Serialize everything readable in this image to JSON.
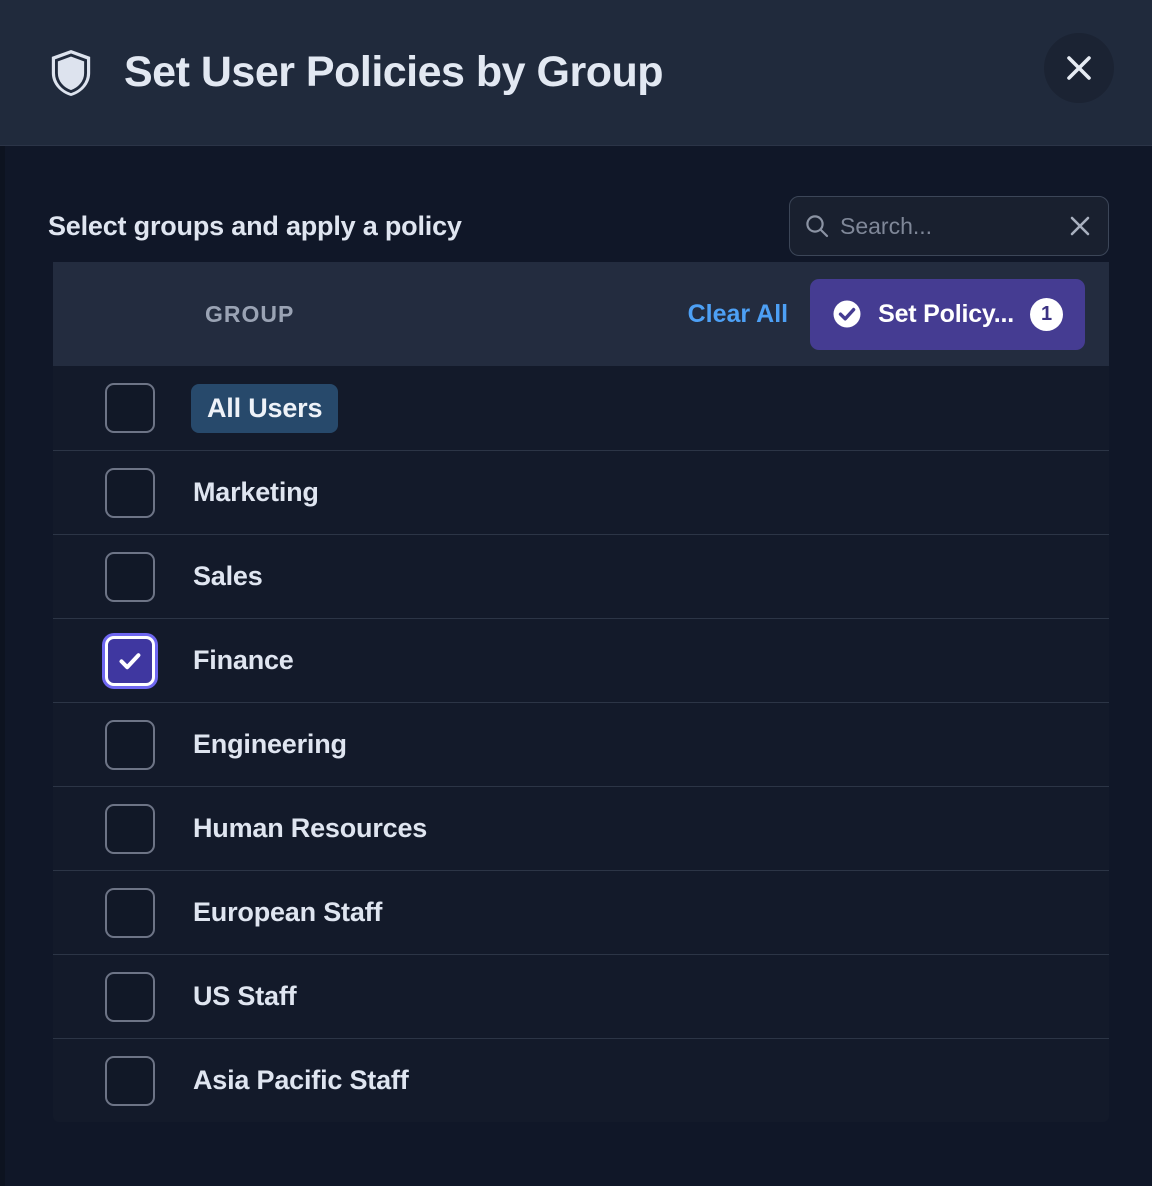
{
  "header": {
    "icon": "shield-icon",
    "title": "Set User Policies by Group",
    "close_icon": "close-icon",
    "background": "#202a3c"
  },
  "body": {
    "section_label": "Select groups and apply a policy",
    "search": {
      "icon": "search-icon",
      "value": "",
      "placeholder": "Search...",
      "clear_icon": "close-icon"
    }
  },
  "table": {
    "column_header": "GROUP",
    "clear_all_label": "Clear All",
    "action_button": {
      "icon": "check-circle-icon",
      "label": "Set Policy...",
      "count": "1",
      "color": "#453c92"
    },
    "rows": [
      {
        "name": "All Users",
        "checked": false,
        "highlighted": true
      },
      {
        "name": "Marketing",
        "checked": false,
        "highlighted": false
      },
      {
        "name": "Sales",
        "checked": false,
        "highlighted": false
      },
      {
        "name": "Finance",
        "checked": true,
        "highlighted": false
      },
      {
        "name": "Engineering",
        "checked": false,
        "highlighted": false
      },
      {
        "name": "Human Resources",
        "checked": false,
        "highlighted": false
      },
      {
        "name": "European Staff",
        "checked": false,
        "highlighted": false
      },
      {
        "name": "US Staff",
        "checked": false,
        "highlighted": false
      },
      {
        "name": "Asia Pacific Staff",
        "checked": false,
        "highlighted": false
      }
    ]
  },
  "colors": {
    "accent_purple": "#453c92",
    "link_blue": "#4da0f5",
    "highlight_chip": "#27496b",
    "checkbox_checked": "#3f37a0",
    "focus_ring": "#6f67f0",
    "page_background": "#0d1320",
    "body_background": "#101728",
    "row_background": "#131a2a",
    "table_head_background": "#232c3f"
  }
}
